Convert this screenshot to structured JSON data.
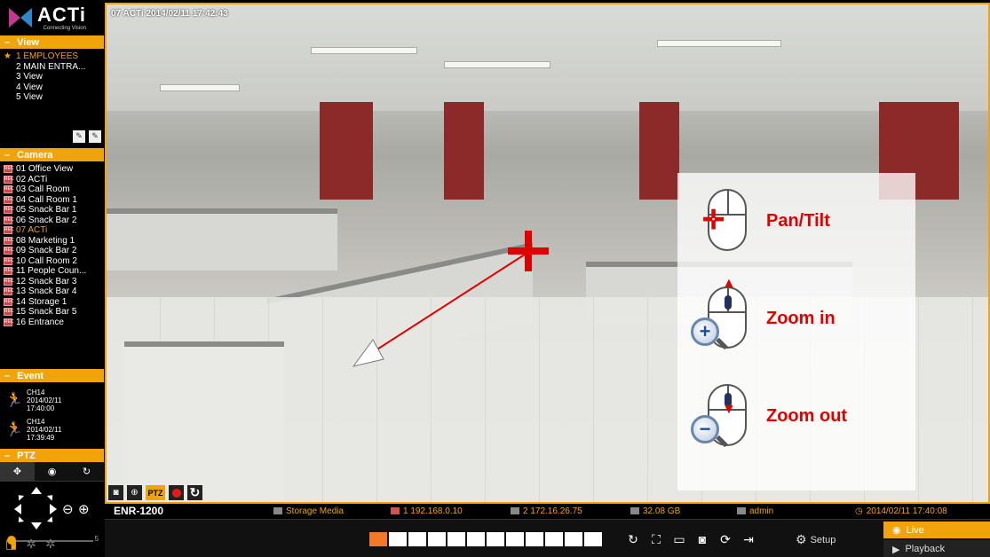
{
  "logo": {
    "brand": "ACTi",
    "tagline": "Connecting Vision"
  },
  "view": {
    "heading": "View",
    "items": [
      {
        "label": "1 EMPLOYEES",
        "active": true
      },
      {
        "label": "2 MAIN ENTRA..."
      },
      {
        "label": "3 View"
      },
      {
        "label": "4 View"
      },
      {
        "label": "5 View"
      }
    ]
  },
  "camera": {
    "heading": "Camera",
    "items": [
      {
        "label": "01 Office View"
      },
      {
        "label": "02 ACTi"
      },
      {
        "label": "03 Call Room"
      },
      {
        "label": "04 Call Room 1"
      },
      {
        "label": "05 Snack Bar 1"
      },
      {
        "label": "06 Snack Bar 2"
      },
      {
        "label": "07 ACTi",
        "active": true
      },
      {
        "label": "08 Marketing 1"
      },
      {
        "label": "09 Snack Bar 2"
      },
      {
        "label": "10 Call Room 2"
      },
      {
        "label": "11 People Coun..."
      },
      {
        "label": "12 Snack Bar 3"
      },
      {
        "label": "13 Snack Bar 4"
      },
      {
        "label": "14 Storage 1"
      },
      {
        "label": "15 Snack Bar 5"
      },
      {
        "label": "16 Entrance"
      }
    ]
  },
  "event": {
    "heading": "Event",
    "items": [
      {
        "channel": "CH14",
        "date": "2014/02/11",
        "time": "17:40:00"
      },
      {
        "channel": "CH14",
        "date": "2014/02/11",
        "time": "17:39:49"
      }
    ]
  },
  "ptz": {
    "heading": "PTZ",
    "speed_max": "5"
  },
  "video": {
    "overlay": "07 ACTi  2014/02/11 17:42:43",
    "help": {
      "pan": "Pan/Tilt",
      "zoom_in": "Zoom in",
      "zoom_out": "Zoom out"
    },
    "ptz_label": "PTZ"
  },
  "status": {
    "model": "ENR-1200",
    "storage": "Storage Media",
    "ip1": "1 192.168.0.10",
    "ip2": "2 172.16.26.75",
    "disk": "32.08 GB",
    "user": "admin",
    "datetime": "2014/02/11 17:40:08"
  },
  "toolbar": {
    "setup": "Setup",
    "live": "Live",
    "playback": "Playback"
  },
  "colors": {
    "accent": "#f0a30a",
    "help_text": "#e10000",
    "video_border": "#f0a30a"
  }
}
